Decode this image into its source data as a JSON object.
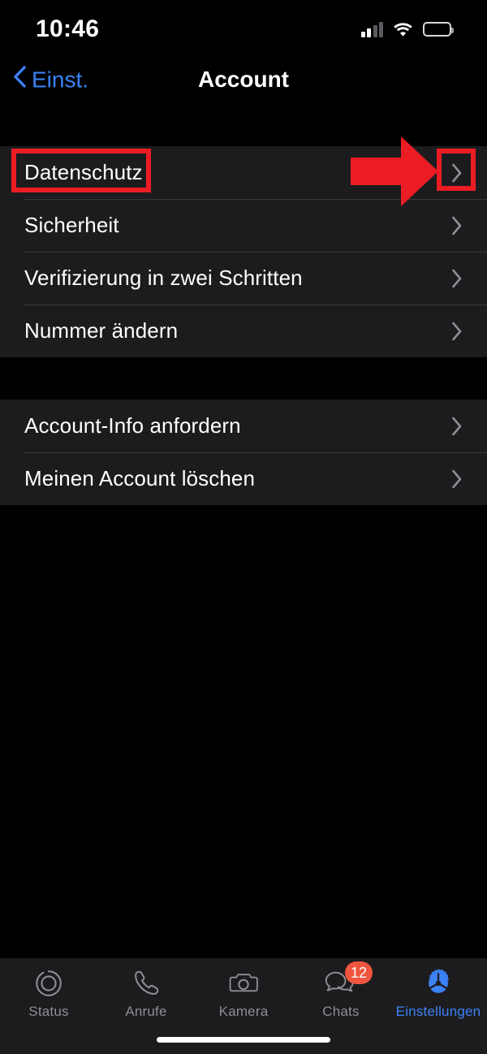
{
  "status_bar": {
    "time": "10:46",
    "signal_icon": "cellular-bars-icon",
    "wifi_icon": "wifi-icon",
    "battery_icon": "battery-low-power-icon",
    "battery_color": "#f5d442"
  },
  "nav_bar": {
    "back_label": "Einst.",
    "back_icon": "chevron-left-icon",
    "title": "Account",
    "accent_color": "#3b82f6"
  },
  "list": {
    "groups": [
      {
        "rows": [
          {
            "label": "Datenschutz",
            "chevron": "chevron-right-icon"
          },
          {
            "label": "Sicherheit",
            "chevron": "chevron-right-icon"
          },
          {
            "label": "Verifizierung in zwei Schritten",
            "chevron": "chevron-right-icon"
          },
          {
            "label": "Nummer ändern",
            "chevron": "chevron-right-icon"
          }
        ]
      },
      {
        "rows": [
          {
            "label": "Account-Info anfordern",
            "chevron": "chevron-right-icon"
          },
          {
            "label": "Meinen Account löschen",
            "chevron": "chevron-right-icon"
          }
        ]
      }
    ]
  },
  "annotations": {
    "color": "#ec1c24",
    "label_highlight_target": "Datenschutz",
    "chevron_highlight_target": "Datenschutz chevron",
    "arrow_icon": "right-arrow-annotation-icon"
  },
  "tab_bar": {
    "tabs": [
      {
        "label": "Status",
        "icon": "status-rings-icon",
        "active": false,
        "badge": ""
      },
      {
        "label": "Anrufe",
        "icon": "phone-handset-icon",
        "active": false,
        "badge": ""
      },
      {
        "label": "Kamera",
        "icon": "camera-icon",
        "active": false,
        "badge": ""
      },
      {
        "label": "Chats",
        "icon": "chat-bubbles-icon",
        "active": false,
        "badge": "12"
      },
      {
        "label": "Einstellungen",
        "icon": "gear-icon",
        "active": true,
        "badge": ""
      }
    ],
    "active_color": "#3b82f6",
    "inactive_color": "#8e8e93",
    "badge_color": "#f0553f"
  },
  "home_indicator": "home-indicator-bar"
}
